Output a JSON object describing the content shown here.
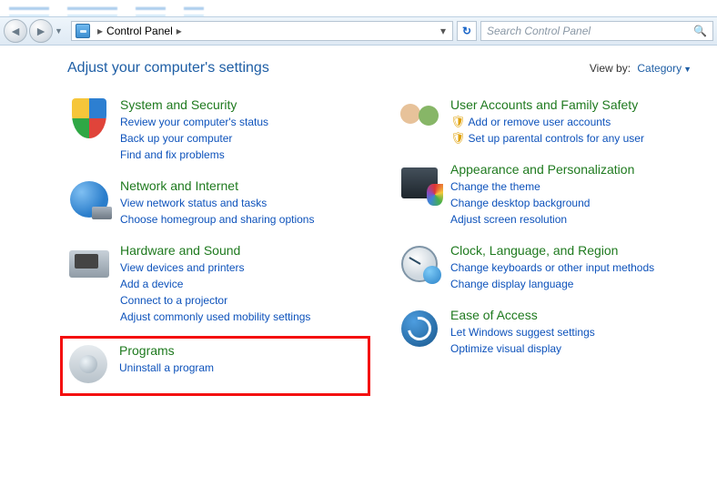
{
  "tabs": [
    "",
    "",
    "",
    ""
  ],
  "breadcrumb": {
    "item": "Control Panel"
  },
  "search": {
    "placeholder": "Search Control Panel"
  },
  "header": {
    "title": "Adjust your computer's settings",
    "viewby_label": "View by:",
    "viewby_value": "Category"
  },
  "categories": {
    "system_security": {
      "title": "System and Security",
      "links": [
        "Review your computer's status",
        "Back up your computer",
        "Find and fix problems"
      ]
    },
    "network": {
      "title": "Network and Internet",
      "links": [
        "View network status and tasks",
        "Choose homegroup and sharing options"
      ]
    },
    "hardware": {
      "title": "Hardware and Sound",
      "links": [
        "View devices and printers",
        "Add a device",
        "Connect to a projector",
        "Adjust commonly used mobility settings"
      ]
    },
    "programs": {
      "title": "Programs",
      "links": [
        "Uninstall a program"
      ]
    },
    "users": {
      "title": "User Accounts and Family Safety",
      "links": [
        "Add or remove user accounts",
        "Set up parental controls for any user"
      ]
    },
    "appearance": {
      "title": "Appearance and Personalization",
      "links": [
        "Change the theme",
        "Change desktop background",
        "Adjust screen resolution"
      ]
    },
    "clock": {
      "title": "Clock, Language, and Region",
      "links": [
        "Change keyboards or other input methods",
        "Change display language"
      ]
    },
    "ease": {
      "title": "Ease of Access",
      "links": [
        "Let Windows suggest settings",
        "Optimize visual display"
      ]
    }
  }
}
